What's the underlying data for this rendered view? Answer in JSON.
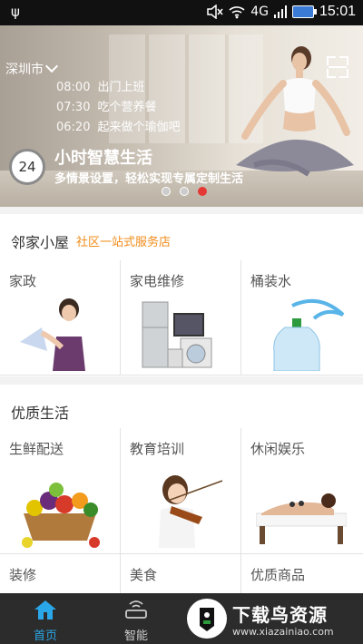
{
  "status_bar": {
    "network": "4G",
    "time": "15:01",
    "icons": [
      "usb-icon",
      "mute-icon",
      "wifi-icon",
      "signal-icon",
      "battery-icon"
    ]
  },
  "banner": {
    "city": "深圳市",
    "schedule": [
      {
        "time": "08:00",
        "text": "出门上班"
      },
      {
        "time": "07:30",
        "text": "吃个营养餐"
      },
      {
        "time": "06:20",
        "text": "起来做个瑜伽吧"
      }
    ],
    "clock_number": "24",
    "title": "小时智慧生活",
    "subtitle": "多情景设置，轻松实现专属定制生活",
    "page_indicator": {
      "total": 3,
      "active": 3
    }
  },
  "section_neighbor": {
    "title": "邻家小屋",
    "tag": "社区一站式服务店",
    "items": [
      {
        "label": "家政",
        "icon": "housekeeper-image"
      },
      {
        "label": "家电维修",
        "icon": "appliances-image"
      },
      {
        "label": "桶装水",
        "icon": "water-bottle-image"
      }
    ]
  },
  "section_quality": {
    "title": "优质生活",
    "items": [
      {
        "label": "生鲜配送",
        "icon": "fruit-basket-image"
      },
      {
        "label": "教育培训",
        "icon": "violin-girl-image"
      },
      {
        "label": "休闲娱乐",
        "icon": "spa-massage-image"
      },
      {
        "label": "装修",
        "icon": ""
      },
      {
        "label": "美食",
        "icon": ""
      },
      {
        "label": "优质商品",
        "icon": ""
      }
    ]
  },
  "tab_bar": {
    "tabs": [
      {
        "label": "首页",
        "icon": "home-icon",
        "active": true
      },
      {
        "label": "智能",
        "icon": "router-icon",
        "active": false
      }
    ],
    "accent_color": "#2aa7e8"
  },
  "watermark": {
    "title": "下载鸟资源",
    "url": "www.xiazainiao.com"
  }
}
